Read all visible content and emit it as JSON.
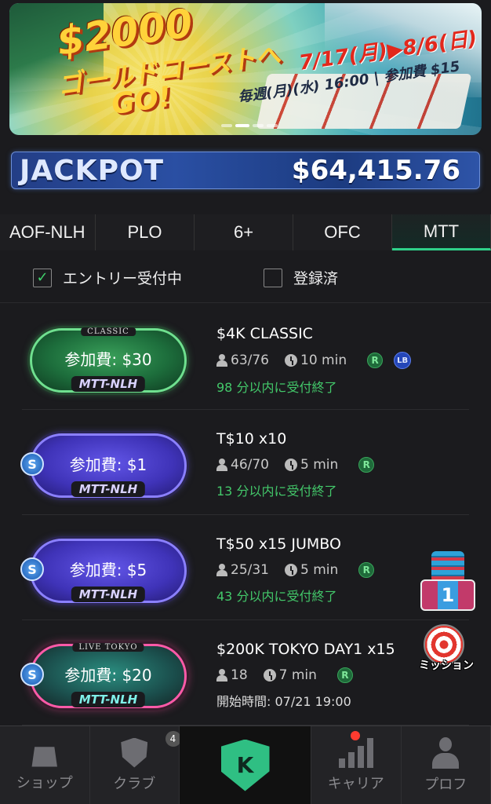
{
  "banner": {
    "amount": "$2000",
    "line2": "ゴールドコーストへ",
    "line3": "GO!",
    "dates": "7/17(月)▶8/6(日)",
    "schedule": "毎週(月)(水) 16:00 | 参加費 $15"
  },
  "jackpot": {
    "label": "JACKPOT",
    "value": "$64,415.76"
  },
  "tabs": [
    {
      "label": "AOF-NLH"
    },
    {
      "label": "PLO"
    },
    {
      "label": "6+"
    },
    {
      "label": "OFC"
    },
    {
      "label": "MTT",
      "active": true
    }
  ],
  "filters": {
    "entry_open": {
      "label": "エントリー受付中",
      "checked": true
    },
    "registered": {
      "label": "登録済",
      "checked": false
    }
  },
  "tournaments": [
    {
      "fee": "参加費: $30",
      "game": "MTT-NLH",
      "cap": "CLASSIC",
      "title": "$4K CLASSIC",
      "players": "63/76",
      "time": "10 min",
      "r": "R",
      "lb": "LB",
      "status": "98 分以内に受付終了"
    },
    {
      "fee": "参加費: $1",
      "game": "MTT-NLH",
      "s": "S",
      "title": "T$10 x10",
      "players": "46/70",
      "time": "5 min",
      "r": "R",
      "status": "13 分以内に受付終了"
    },
    {
      "fee": "参加費: $5",
      "game": "MTT-NLH",
      "s": "S",
      "title": "T$50 x15 JUMBO",
      "players": "25/31",
      "time": "5 min",
      "r": "R",
      "status": "43 分以内に受付終了"
    },
    {
      "fee": "参加費: $20",
      "game": "MTT-NLH",
      "cap": "LIVE TOKYO",
      "s": "S",
      "title": "$200K TOKYO DAY1 x15",
      "players": "18",
      "time": "7 min",
      "r": "R",
      "status": "開始時間: 07/21 19:00"
    }
  ],
  "floating": {
    "rank_number": "1",
    "mission_label": "ミッション"
  },
  "bottom_nav": {
    "shop": "ショップ",
    "club": "クラブ",
    "club_count": "4",
    "career": "キャリア",
    "profile": "プロフ"
  },
  "colors": {
    "accent": "#2fd18a",
    "deadline": "#43c86a"
  }
}
